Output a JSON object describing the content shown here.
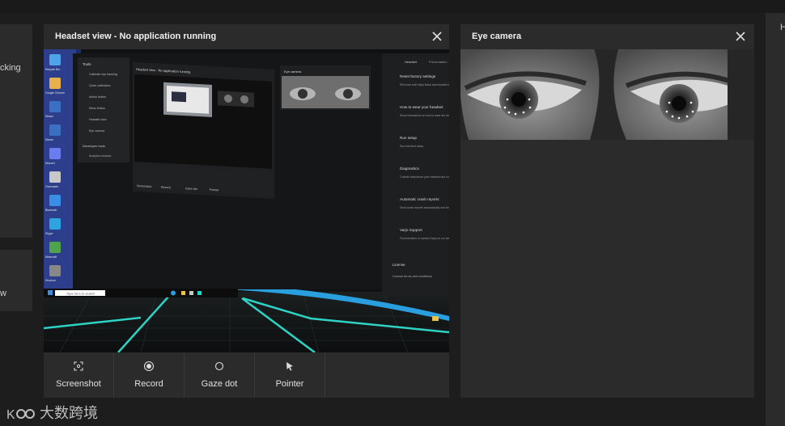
{
  "left_panel": {
    "top_clip_text": "cking",
    "bottom_clip_text": "w"
  },
  "right_panel": {
    "clip_text": "H"
  },
  "headset_window": {
    "title": "Headset view - No application running",
    "toolbar": [
      {
        "label": "Screenshot",
        "icon": "screenshot-icon"
      },
      {
        "label": "Record",
        "icon": "record-icon"
      },
      {
        "label": "Gaze dot",
        "icon": "gaze-dot-icon"
      },
      {
        "label": "Pointer",
        "icon": "pointer-icon"
      }
    ],
    "vr_scene": {
      "desktop_icons": [
        "Recycle Bin",
        "Google Chrome",
        "Steam",
        "Steam",
        "Discord",
        "Overwatch",
        "Bluetooth",
        "Skype",
        "Minecraft",
        "Shortcut"
      ],
      "tools_menu": {
        "heading": "Tools",
        "items": [
          "Calibrate eye tracking",
          "Quick calibration",
          "Action button",
          "Menu button",
          "Headset view",
          "Eye camera"
        ],
        "dev_heading": "Developer tools",
        "dev_items": [
          "Analytics window"
        ]
      },
      "inner_headset_title": "Headset view - No application running",
      "inner_eye_title": "Eye camera",
      "inner_toolbar": [
        "Screenshot",
        "Record",
        "Gaze dot",
        "Pointer"
      ],
      "settings_tabs": [
        "Headset",
        "Presentation"
      ],
      "settings_sections": [
        {
          "title": "Reset factory settings",
          "desc": "Will reset both Varjo Base and headset to factory settings ordered."
        },
        {
          "title": "How to wear your headset",
          "desc": "Show instructions on how to wear the headset and the image quality."
        },
        {
          "title": "Run setup",
          "desc": "Run first time setup."
        },
        {
          "title": "Diagnostics",
          "desc": "Collects data about your headset and computer for diagnosis."
        },
        {
          "title": "Automatic crash reports",
          "desc": "Send crash reports automatically and help us improve."
        },
        {
          "title": "Varjo Support",
          "desc": "Find solutions or contact Varjo on our website."
        }
      ],
      "license": {
        "title": "License",
        "desc": "License terms and conditions"
      },
      "taskbar_search": "Type here to search"
    }
  },
  "eye_window": {
    "title": "Eye camera"
  },
  "watermark": {
    "text": "大数跨境"
  },
  "colors": {
    "accent_blue": "#2a9fe0",
    "teal_grid": "#2fd3c4",
    "window_bg": "#2b2b2b",
    "page_bg": "#1d1d1d"
  }
}
